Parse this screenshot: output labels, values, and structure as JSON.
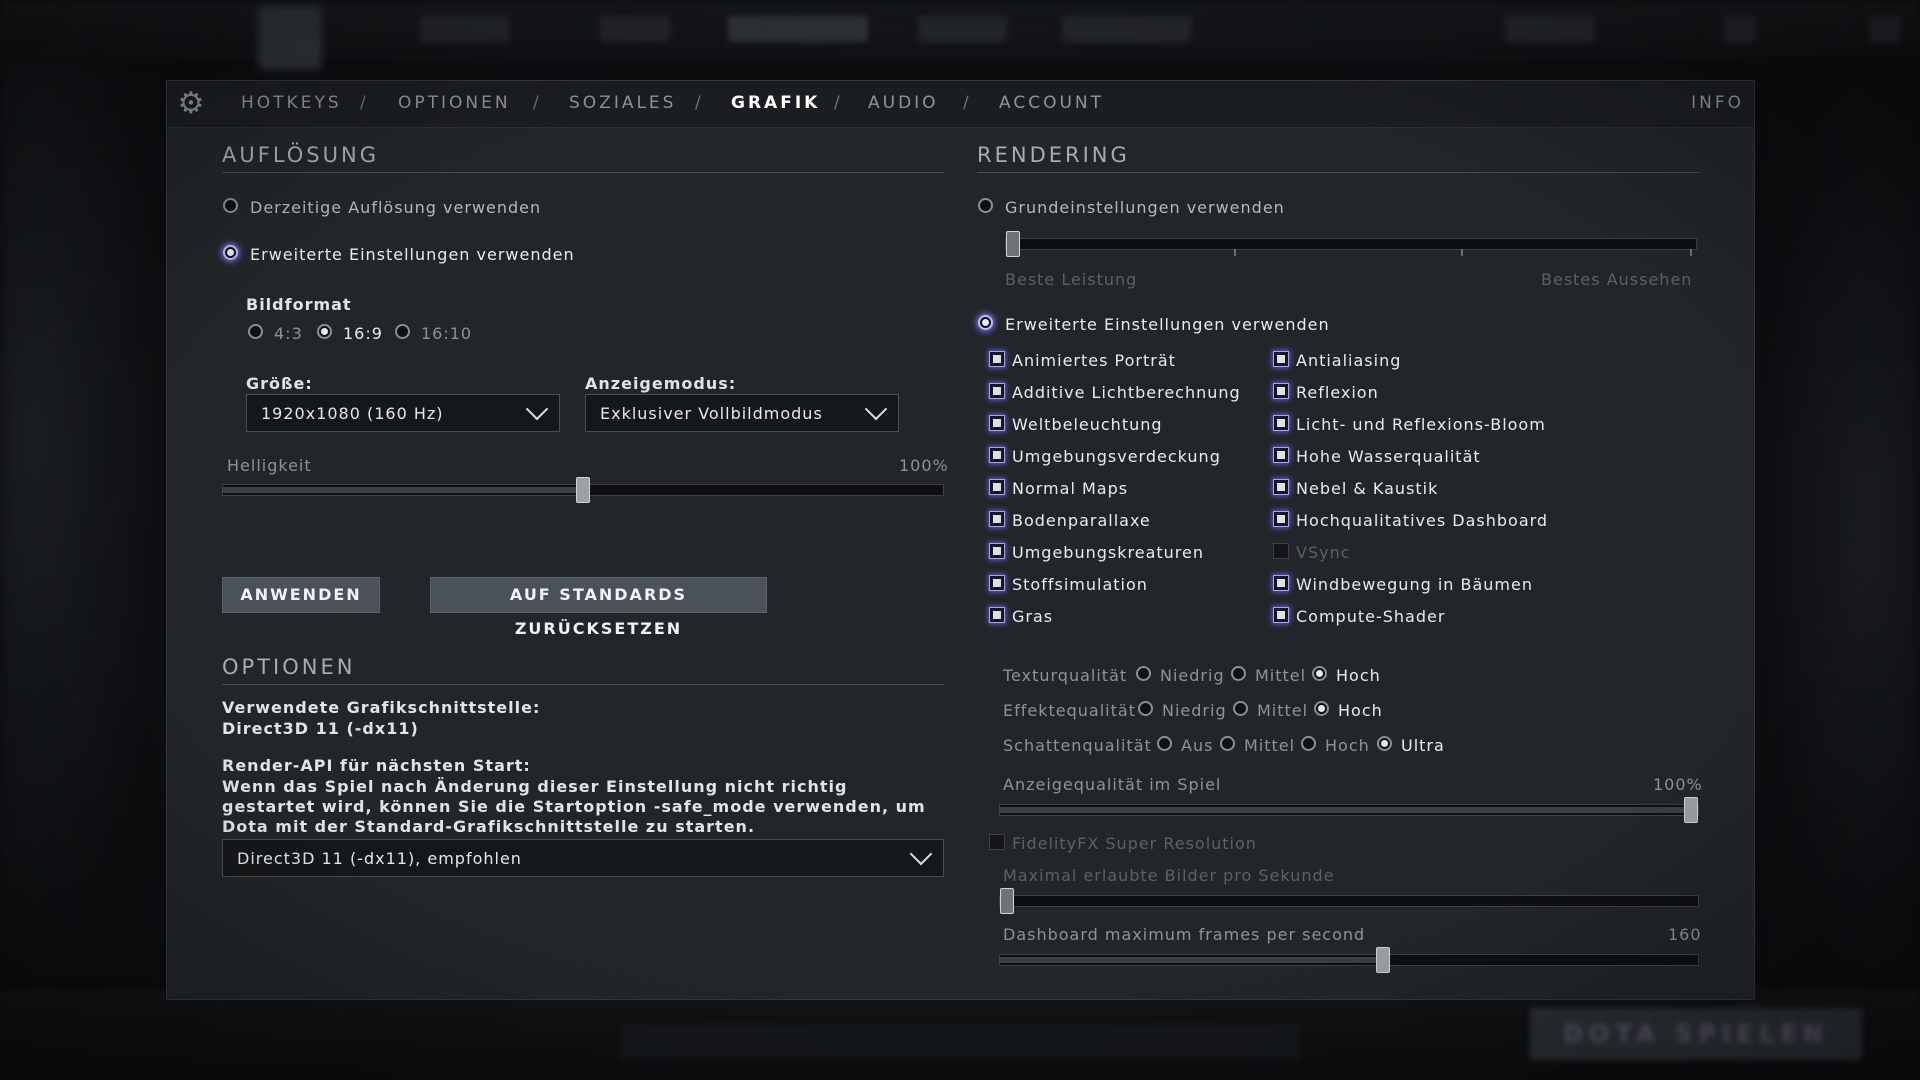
{
  "background": {
    "play_button": "DOTA SPIELEN",
    "nav_items": [
      "HELDEN",
      "SHOP",
      "ZUSCHAUEN",
      "LERNEN",
      "SPIELHALLE"
    ]
  },
  "tabs": {
    "items": [
      "HOTKEYS",
      "OPTIONEN",
      "SOZIALES",
      "GRAFIK",
      "AUDIO",
      "ACCOUNT"
    ],
    "active": "GRAFIK",
    "separator": "/",
    "info": "INFO"
  },
  "resolution": {
    "title": "AUFLÖSUNG",
    "use_current": "Derzeitige Auflösung verwenden",
    "use_advanced": "Erweiterte Einstellungen verwenden",
    "aspect_label": "Bildformat",
    "aspect_options": [
      "4:3",
      "16:9",
      "16:10"
    ],
    "aspect_selected": "16:9",
    "size_label": "Größe:",
    "size_value": "1920x1080 (160 Hz)",
    "display_mode_label": "Anzeigemodus:",
    "display_mode_value": "Exklusiver Vollbildmodus",
    "brightness_label": "Helligkeit",
    "brightness_value": "100%",
    "brightness_fraction": 0.5,
    "apply_button": "ANWENDEN",
    "reset_button": "AUF STANDARDS ZURÜCKSETZEN"
  },
  "options": {
    "title": "OPTIONEN",
    "api_used_label": "Verwendete Grafikschnittstelle:",
    "api_used_value": "Direct3D 11 (-dx11)",
    "render_api_label": "Render-API für nächsten Start:",
    "render_api_note": "Wenn das Spiel nach Änderung dieser Einstellung nicht richtig gestartet wird, können Sie die Startoption -safe_mode verwenden, um Dota mit der Standard-Grafikschnittstelle zu starten.",
    "render_api_value": "Direct3D 11 (-dx11), empfohlen"
  },
  "rendering": {
    "title": "RENDERING",
    "use_basic": "Grundeinstellungen verwenden",
    "perf_left": "Beste Leistung",
    "perf_right": "Bestes Aussehen",
    "use_advanced": "Erweiterte Einstellungen verwenden",
    "checkboxes_left": [
      {
        "label": "Animiertes Porträt",
        "checked": true
      },
      {
        "label": "Additive Lichtberechnung",
        "checked": true
      },
      {
        "label": "Weltbeleuchtung",
        "checked": true
      },
      {
        "label": "Umgebungsverdeckung",
        "checked": true
      },
      {
        "label": "Normal Maps",
        "checked": true
      },
      {
        "label": "Bodenparallaxe",
        "checked": true
      },
      {
        "label": "Umgebungskreaturen",
        "checked": true
      },
      {
        "label": "Stoffsimulation",
        "checked": true
      },
      {
        "label": "Gras",
        "checked": true
      }
    ],
    "checkboxes_right": [
      {
        "label": "Antialiasing",
        "checked": true
      },
      {
        "label": "Reflexion",
        "checked": true
      },
      {
        "label": "Licht- und Reflexions-Bloom",
        "checked": true
      },
      {
        "label": "Hohe Wasserqualität",
        "checked": true
      },
      {
        "label": "Nebel & Kaustik",
        "checked": true
      },
      {
        "label": "Hochqualitatives Dashboard",
        "checked": true
      },
      {
        "label": "VSync",
        "checked": false
      },
      {
        "label": "Windbewegung in Bäumen",
        "checked": true
      },
      {
        "label": "Compute-Shader",
        "checked": true
      }
    ],
    "texture_label": "Texturqualität",
    "texture_options": [
      "Niedrig",
      "Mittel",
      "Hoch"
    ],
    "texture_selected": "Hoch",
    "effect_label": "Effektequalität",
    "effect_options": [
      "Niedrig",
      "Mittel",
      "Hoch"
    ],
    "effect_selected": "Hoch",
    "shadow_label": "Schattenqualität",
    "shadow_options": [
      "Aus",
      "Mittel",
      "Hoch",
      "Ultra"
    ],
    "shadow_selected": "Ultra",
    "render_quality_label": "Anzeigequalität im Spiel",
    "render_quality_value": "100%",
    "render_quality_fraction": 1.0,
    "fsr_label": "FidelityFX Super Resolution",
    "max_fps_label": "Maximal erlaubte Bilder pro Sekunde",
    "max_fps_fraction": 0.0,
    "dashboard_fps_label": "Dashboard maximum frames per second",
    "dashboard_fps_value": "160",
    "dashboard_fps_fraction": 0.55
  }
}
